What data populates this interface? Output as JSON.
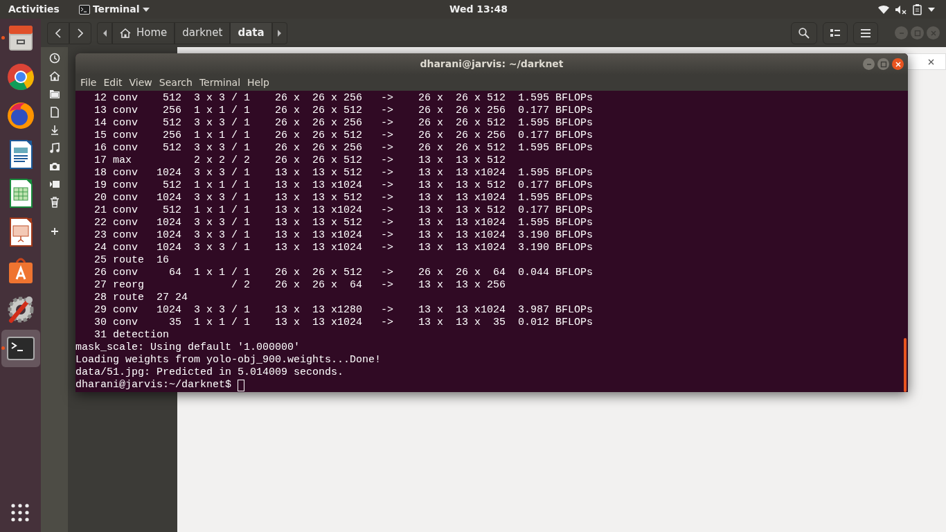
{
  "top_bar": {
    "activities": "Activities",
    "app_menu": "Terminal",
    "clock": "Wed 13:48"
  },
  "dock": [
    {
      "kind": "files",
      "running": true,
      "selected": false
    },
    {
      "kind": "chrome",
      "running": false,
      "selected": false
    },
    {
      "kind": "firefox",
      "running": false,
      "selected": false
    },
    {
      "kind": "writer",
      "running": false,
      "selected": false
    },
    {
      "kind": "calc",
      "running": false,
      "selected": false
    },
    {
      "kind": "impress",
      "running": false,
      "selected": false
    },
    {
      "kind": "software",
      "running": false,
      "selected": false
    },
    {
      "kind": "settings",
      "running": false,
      "selected": false
    },
    {
      "kind": "terminal",
      "running": true,
      "selected": true
    }
  ],
  "file_manager": {
    "path": [
      {
        "label": "Home",
        "kind": "home",
        "selected": false
      },
      {
        "label": "darknet",
        "kind": "folder",
        "selected": false
      },
      {
        "label": "data",
        "kind": "folder",
        "selected": true
      }
    ]
  },
  "terminal": {
    "title": "dharani@jarvis: ~/darknet",
    "menu": [
      "File",
      "Edit",
      "View",
      "Search",
      "Terminal",
      "Help"
    ],
    "lines": [
      "   12 conv    512  3 x 3 / 1    26 x  26 x 256   ->    26 x  26 x 512  1.595 BFLOPs",
      "   13 conv    256  1 x 1 / 1    26 x  26 x 512   ->    26 x  26 x 256  0.177 BFLOPs",
      "   14 conv    512  3 x 3 / 1    26 x  26 x 256   ->    26 x  26 x 512  1.595 BFLOPs",
      "   15 conv    256  1 x 1 / 1    26 x  26 x 512   ->    26 x  26 x 256  0.177 BFLOPs",
      "   16 conv    512  3 x 3 / 1    26 x  26 x 256   ->    26 x  26 x 512  1.595 BFLOPs",
      "   17 max          2 x 2 / 2    26 x  26 x 512   ->    13 x  13 x 512",
      "   18 conv   1024  3 x 3 / 1    13 x  13 x 512   ->    13 x  13 x1024  1.595 BFLOPs",
      "   19 conv    512  1 x 1 / 1    13 x  13 x1024   ->    13 x  13 x 512  0.177 BFLOPs",
      "   20 conv   1024  3 x 3 / 1    13 x  13 x 512   ->    13 x  13 x1024  1.595 BFLOPs",
      "   21 conv    512  1 x 1 / 1    13 x  13 x1024   ->    13 x  13 x 512  0.177 BFLOPs",
      "   22 conv   1024  3 x 3 / 1    13 x  13 x 512   ->    13 x  13 x1024  1.595 BFLOPs",
      "   23 conv   1024  3 x 3 / 1    13 x  13 x1024   ->    13 x  13 x1024  3.190 BFLOPs",
      "   24 conv   1024  3 x 3 / 1    13 x  13 x1024   ->    13 x  13 x1024  3.190 BFLOPs",
      "   25 route  16",
      "   26 conv     64  1 x 1 / 1    26 x  26 x 512   ->    26 x  26 x  64  0.044 BFLOPs",
      "   27 reorg              / 2    26 x  26 x  64   ->    13 x  13 x 256",
      "   28 route  27 24",
      "   29 conv   1024  3 x 3 / 1    13 x  13 x1280   ->    13 x  13 x1024  3.987 BFLOPs",
      "   30 conv     35  1 x 1 / 1    13 x  13 x1024   ->    13 x  13 x  35  0.012 BFLOPs",
      "   31 detection",
      "mask_scale: Using default '1.000000'",
      "Loading weights from yolo-obj_900.weights...Done!",
      "data/51.jpg: Predicted in 5.014009 seconds."
    ],
    "prompt": "dharani@jarvis:~/darknet$"
  }
}
